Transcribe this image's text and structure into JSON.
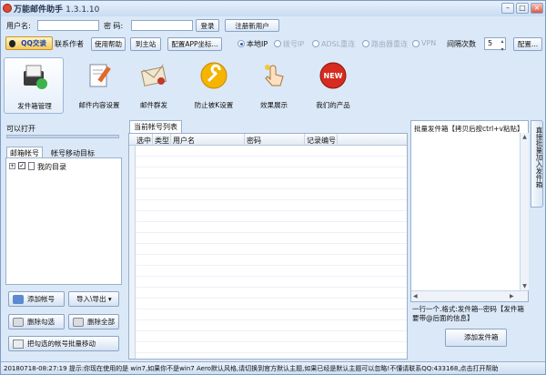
{
  "window": {
    "title": "万能邮件助手",
    "version": "1.3.1.10"
  },
  "login": {
    "username_label": "用户名:",
    "password_label": "密 码:",
    "login_button": "登录",
    "register_button": "注册新用户"
  },
  "toolbar": {
    "qq_button": "QQ交谈",
    "contact_author": "联系作者",
    "help_button": "使用帮助",
    "main_site": "到主站",
    "config_app": "配置APP坐标...",
    "radio_local": "本地IP",
    "radio_ip2": "拨号IP",
    "radio_ip3": "ADSL重连",
    "radio_ip4": "路由器重连",
    "radio_ip5": "VPN",
    "interval_label": "间隔次数",
    "interval_value": "5",
    "config_button": "配置..."
  },
  "modules": [
    {
      "label": "发件箱管理",
      "icon": "mailbox-icon"
    },
    {
      "label": "邮件内容设置",
      "icon": "document-pencil-icon"
    },
    {
      "label": "邮件群发",
      "icon": "envelope-icon"
    },
    {
      "label": "防止被K设置",
      "icon": "wrench-icon"
    },
    {
      "label": "效果展示",
      "icon": "pointer-hand-icon"
    },
    {
      "label": "我们的产品",
      "icon": "new-badge-icon"
    }
  ],
  "left": {
    "can_open": "可以打开",
    "tab_accounts": "邮箱帐号",
    "tab_move_target": "帐号移动目标",
    "tree_item": "我的目录",
    "add_account": "添加帐号",
    "import_export": "导入\\导出",
    "delete_checked": "删除勾选",
    "delete_all": "删除全部",
    "batch_move": "把勾选的帐号批量移动"
  },
  "center": {
    "tab": "当前帐号列表",
    "columns": [
      "选中",
      "类型",
      "用户名",
      "密码",
      "记录编号"
    ]
  },
  "right": {
    "header": "批量发件箱【拷贝后按ctrl+v粘贴】",
    "side_tab": "直接批量加入发件箱",
    "hint": "一行一个.格式:发件箱--密码【发件箱要带@后面的信息】",
    "add_button": "添加发件箱"
  },
  "status": {
    "text": "20180718-08:27:19  提示:你现在使用的是 win7,如果你不是win7 Aero默认风格,请切换到官方默认主题,如果已经是默认主题可以忽略!不懂请联系QQ:433168,点击打开帮助"
  }
}
